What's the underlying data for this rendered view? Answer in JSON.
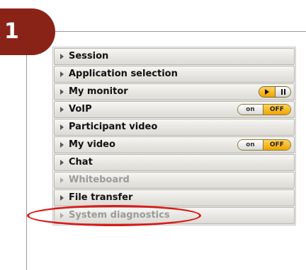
{
  "step_number": "1",
  "colors": {
    "badge": "#8a2317",
    "highlight": "#d91a1a",
    "toggle_off_active": "#f0a400"
  },
  "panel": {
    "items": [
      {
        "label": "Session",
        "enabled": true,
        "control": "none"
      },
      {
        "label": "Application selection",
        "enabled": true,
        "control": "none"
      },
      {
        "label": "My monitor",
        "enabled": true,
        "control": "play-pause"
      },
      {
        "label": "VoIP",
        "enabled": true,
        "control": "on-off",
        "on_label": "on",
        "off_label": "OFF",
        "state": "off"
      },
      {
        "label": "Participant video",
        "enabled": true,
        "control": "none"
      },
      {
        "label": "My video",
        "enabled": true,
        "control": "on-off",
        "on_label": "on",
        "off_label": "OFF",
        "state": "off"
      },
      {
        "label": "Chat",
        "enabled": true,
        "control": "none"
      },
      {
        "label": "Whiteboard",
        "enabled": false,
        "control": "none"
      },
      {
        "label": "File transfer",
        "enabled": true,
        "control": "none",
        "highlighted": true
      },
      {
        "label": "System diagnostics",
        "enabled": false,
        "control": "none"
      }
    ]
  }
}
